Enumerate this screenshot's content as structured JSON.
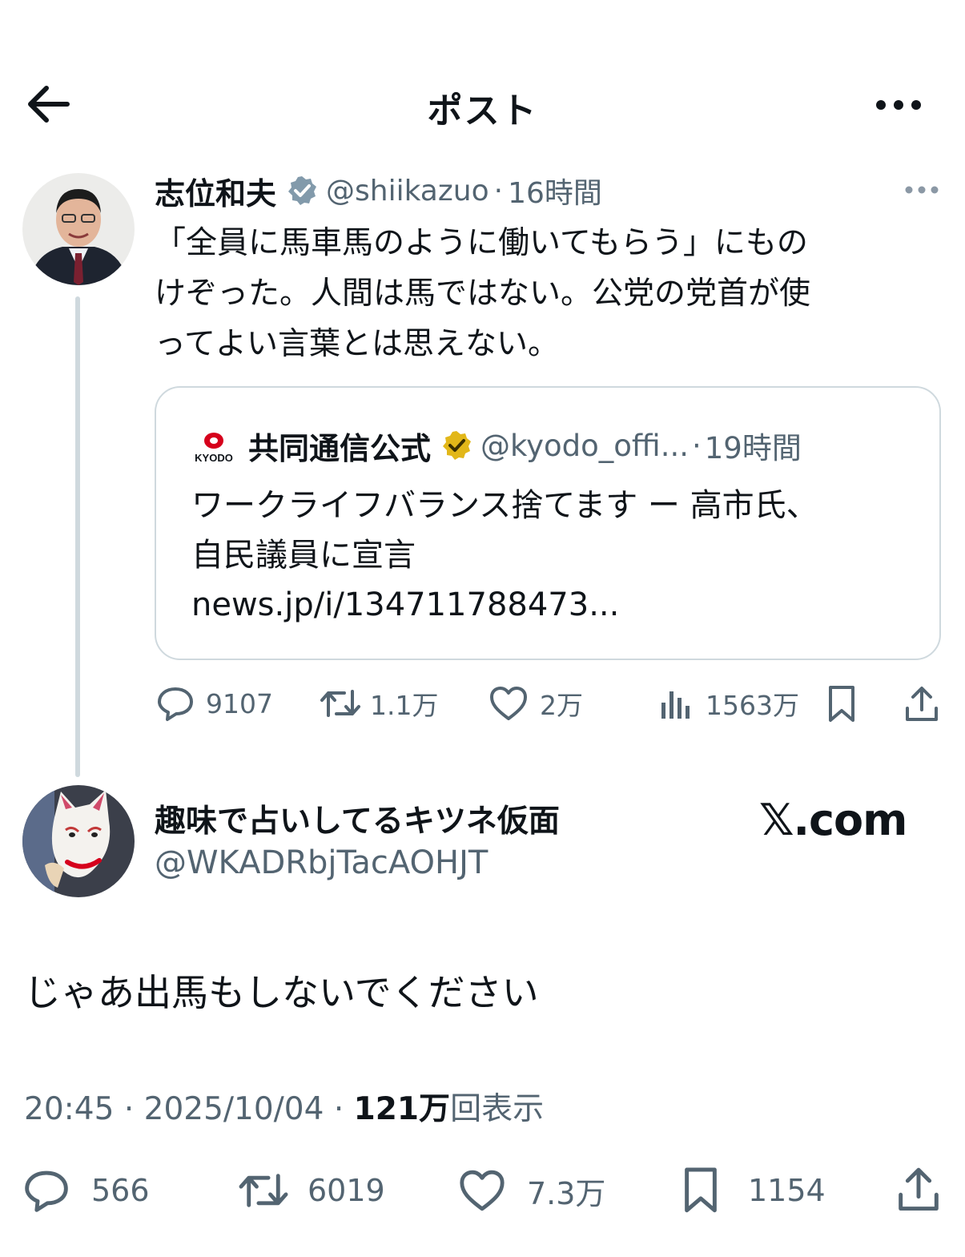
{
  "header": {
    "title": "ポスト"
  },
  "tweet1": {
    "name": "志位和夫",
    "handle": "@shiikazuo",
    "separator": "·",
    "time": "16時間",
    "text_lines": [
      "「全員に馬車馬のように働いてもらう」にもの",
      "けぞった。人間は馬ではない。公党の党首が使",
      "ってよい言葉とは思えない。"
    ],
    "quote": {
      "logo_text": "KYODO",
      "name": "共同通信公式",
      "handle": "@kyodo_offi...",
      "separator": "·",
      "time": "19時間",
      "text_lines": [
        "ワークライフバランス捨てます ー 高市氏、",
        "自民議員に宣言",
        "news.jp/i/134711788473..."
      ]
    },
    "actions": {
      "replies": "9107",
      "reposts": "1.1万",
      "likes": "2万",
      "views": "1563万"
    },
    "colors": {
      "verified_badge": "#829aab",
      "line": "#cfd9de"
    }
  },
  "tweet2": {
    "name": "趣味で占いしてるキツネ仮面",
    "handle": "@WKADRbjTacAOHJT",
    "watermark": "𝕏.com",
    "text": "じゃあ出馬もしないでください",
    "meta": {
      "time": "20:45",
      "separator": "·",
      "date": "2025/10/04",
      "views_count": "121万",
      "views_label": "回表示"
    },
    "actions": {
      "replies": "566",
      "reposts": "6019",
      "likes": "7.3万",
      "bookmarks": "1154"
    }
  },
  "icons": {
    "back": "arrow-left-icon",
    "more": "more-horizontal-icon",
    "verified": "verified-badge-icon",
    "gold_verified": "gold-verified-badge-icon",
    "reply": "reply-icon",
    "repost": "repost-icon",
    "like": "heart-icon",
    "views": "views-chart-icon",
    "bookmark": "bookmark-icon",
    "share": "share-icon"
  },
  "colors": {
    "text_primary": "#0f1419",
    "text_secondary": "#536471",
    "gold_badge": "#e2b719",
    "kyodo_red": "#d6001c"
  }
}
